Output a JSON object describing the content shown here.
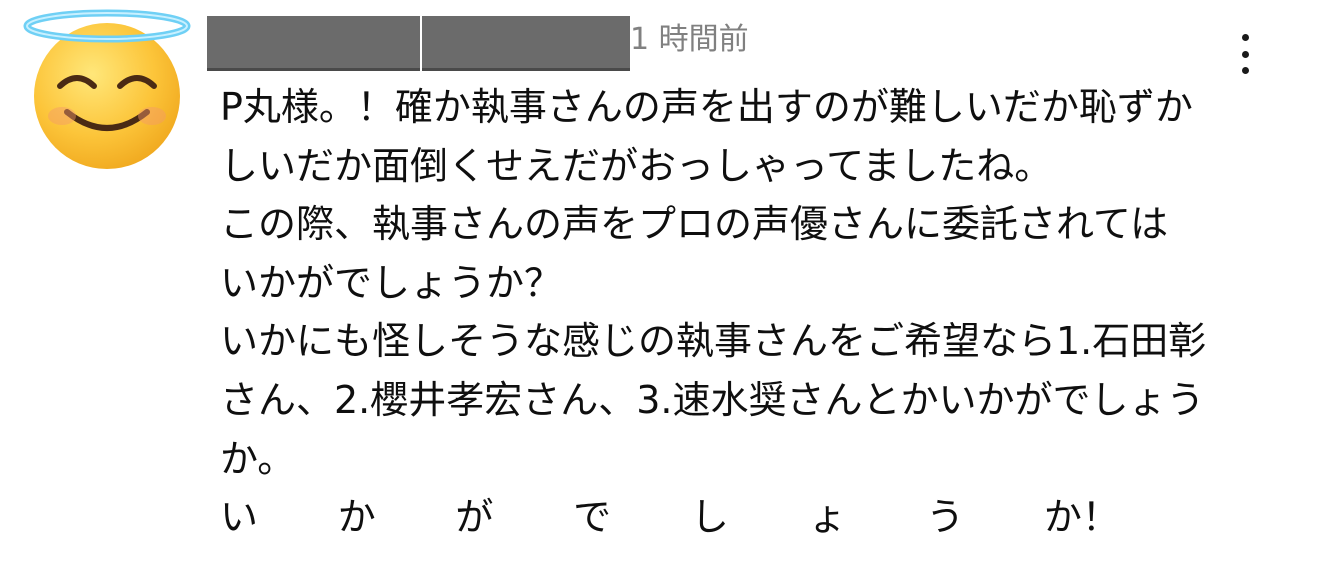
{
  "comment": {
    "author_redacted": true,
    "timestamp": "1 時間前",
    "menu_icon": "more-vertical-icon",
    "avatar_icon": "smiling-face-with-halo-icon",
    "lines": [
      "P丸様。！確か執事さんの声を出すのが難しいだか恥ずか",
      "しいだか面倒くせえだがおっしゃってましたね。",
      "この際、執事さんの声をプロの声優さんに委託されては",
      "いかがでしょうか？",
      "いかにも怪しそうな感じの執事さんをご希望なら1.石田彰",
      "さん、2.櫻井孝宏さん、3.速水奨さんとかいかがでしょう",
      "か。"
    ],
    "spaced_chars": [
      "い",
      "か",
      "が",
      "で",
      "し",
      "ょ",
      "う",
      "か！"
    ]
  }
}
